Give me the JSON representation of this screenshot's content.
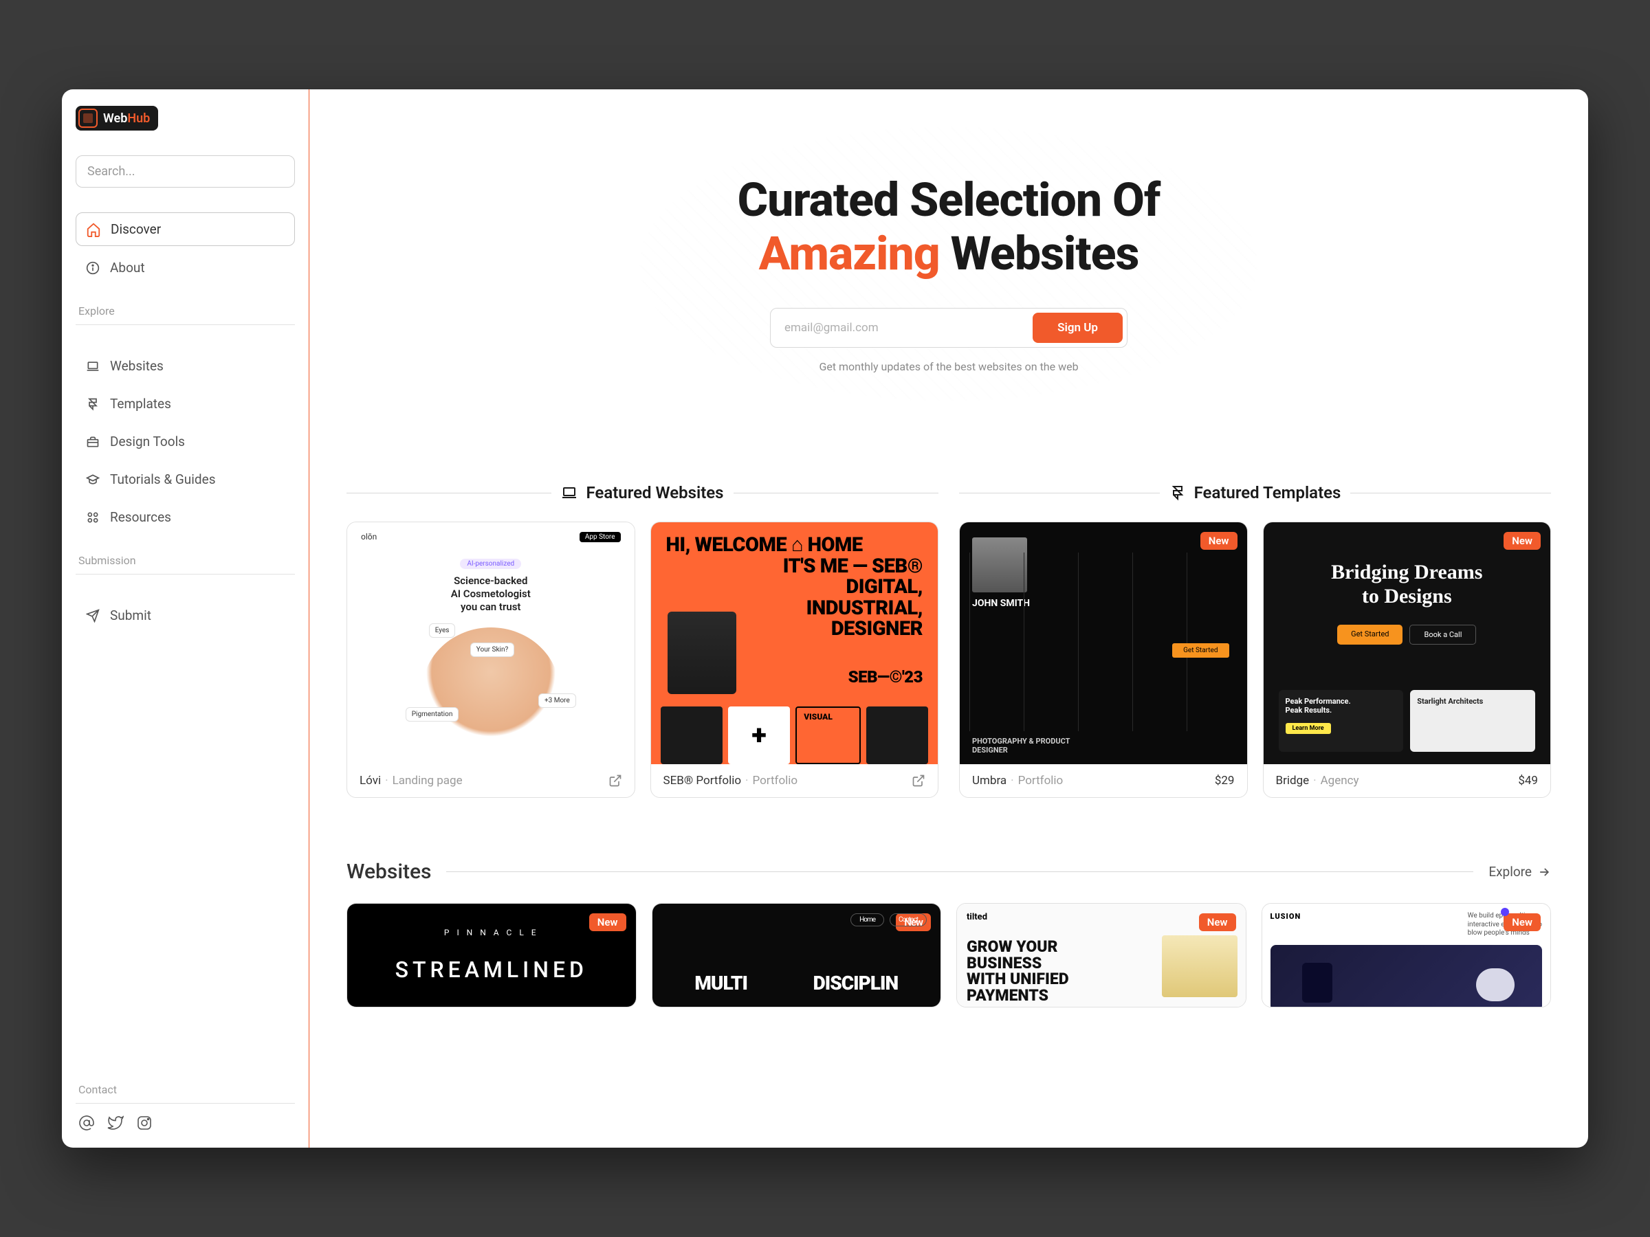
{
  "brand": {
    "name_a": "Web",
    "name_b": "Hub"
  },
  "search": {
    "placeholder": "Search..."
  },
  "nav": {
    "discover": "Discover",
    "about": "About"
  },
  "explore": {
    "label": "Explore",
    "websites": "Websites",
    "templates": "Templates",
    "design_tools": "Design Tools",
    "tutorials": "Tutorials & Guides",
    "resources": "Resources"
  },
  "submission": {
    "label": "Submission",
    "submit": "Submit"
  },
  "contact": {
    "label": "Contact"
  },
  "hero": {
    "line1": "Curated Selection Of",
    "accent": "Amazing",
    "line2_rest": " Websites",
    "email_placeholder": "email@gmail.com",
    "signup": "Sign Up",
    "sub": "Get monthly updates of the best websites on the web"
  },
  "featured": {
    "websites_title": "Featured Websites",
    "templates_title": "Featured Templates",
    "badge_new": "New",
    "cards": {
      "lovi": {
        "title": "Lóvi",
        "category": "Landing page",
        "inner": {
          "brand": "olōn",
          "appstore": "App Store",
          "tag": "AI-personalized",
          "headline": "Science-backed\nAI Cosmetologist\nyou can trust",
          "label_eyes": "Eyes",
          "label_skin": "Your Skin?",
          "label_pig": "Pigmentation",
          "label_more": "+3 More"
        }
      },
      "seb": {
        "title": "SEB® Portfolio",
        "category": "Portfolio",
        "inner": {
          "l1": "HI, WELCOME ⌂ HOME",
          "l2": "IT'S ME — SEB®",
          "l3": "DIGITAL,",
          "l4": "INDUSTRIAL,",
          "l5": "DESIGNER",
          "cw": "SEB—©'23"
        }
      },
      "umbra": {
        "title": "Umbra",
        "category": "Portfolio",
        "price": "$29",
        "inner": {
          "name": "JOHN SMITH",
          "cta": "Get Started",
          "foot": "PHOTOGRAPHY & PRODUCT\nDESIGNER"
        }
      },
      "bridge": {
        "title": "Bridge",
        "category": "Agency",
        "price": "$49",
        "inner": {
          "headline": "Bridging Dreams\nto Designs",
          "btn1": "Get Started",
          "btn2": "Book a Call",
          "tile1": "Peak Performance.\nPeak Results.",
          "tile1_btn": "Learn More",
          "tile2": "Starlight Architects"
        }
      }
    }
  },
  "websites_section": {
    "title": "Websites",
    "explore": "Explore",
    "cards": {
      "pinnacle": {
        "logo": "P I N N A C L E",
        "text": "STREAMLINED"
      },
      "multi": {
        "pill1": "Home",
        "pill2": "Contact",
        "w1": "MULTI",
        "w2": "DISCIPLIN"
      },
      "tilted": {
        "brand": "tilted",
        "text": "GROW YOUR\nBUSINESS\nWITH UNIFIED\nPAYMENTS"
      },
      "lusion": {
        "brand": "LUSION",
        "tagline": "We build epic realtime\ninteractive experience to\nblow people's minds"
      }
    }
  }
}
